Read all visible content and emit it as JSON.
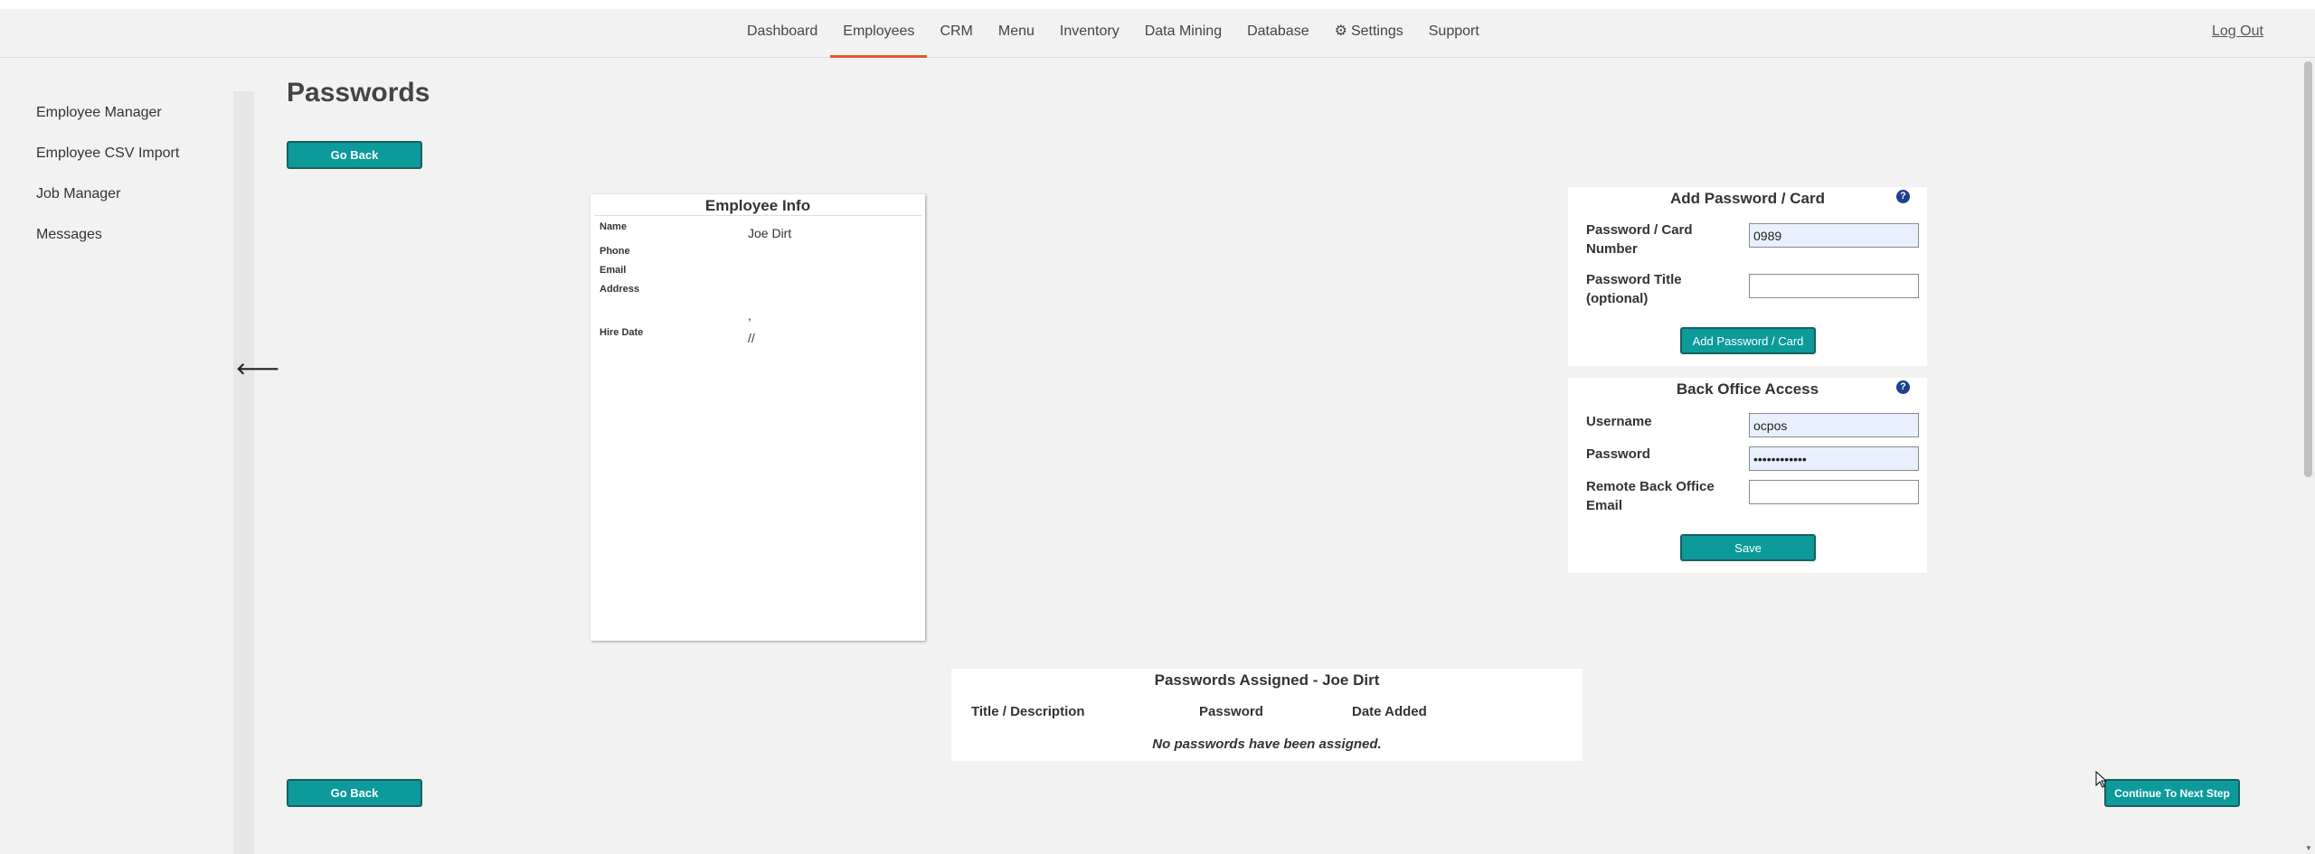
{
  "nav": {
    "links": [
      "Dashboard",
      "Employees",
      "CRM",
      "Menu",
      "Inventory",
      "Data Mining",
      "Database",
      "Settings",
      "Support"
    ],
    "active": "Employees",
    "logout": "Log Out"
  },
  "sidebar": {
    "items": [
      "Employee Manager",
      "Employee CSV Import",
      "Job Manager",
      "Messages"
    ]
  },
  "page": {
    "title": "Passwords",
    "go_back": "Go Back",
    "continue": "Continue To Next Step"
  },
  "employee_info": {
    "title": "Employee Info",
    "labels": {
      "name": "Name",
      "phone": "Phone",
      "email": "Email",
      "address": "Address",
      "hire_date": "Hire Date"
    },
    "values": {
      "name": "Joe Dirt",
      "phone": "",
      "email": "",
      "address_line": ",",
      "hire_date": "//"
    }
  },
  "add_password": {
    "title": "Add Password / Card",
    "number_label_1": "Password / Card",
    "number_label_2": "Number",
    "number_value": "0989",
    "title_label_1": "Password Title",
    "title_label_2": "(optional)",
    "title_value": "",
    "button": "Add Password / Card"
  },
  "back_office": {
    "title": "Back Office Access",
    "username_label": "Username",
    "username_value": "ocpos",
    "password_label": "Password",
    "password_value": "••••••••••••",
    "email_label_1": "Remote Back Office",
    "email_label_2": "Email",
    "email_value": "",
    "button": "Save"
  },
  "assigned": {
    "title": "Passwords Assigned - Joe Dirt",
    "columns": [
      "Title / Description",
      "Password",
      "Date Added"
    ],
    "empty_message": "No passwords have been assigned."
  },
  "icons": {
    "help": "question-circle-icon",
    "collapse": "arrow-left-icon",
    "settings": "gear-icon"
  },
  "colors": {
    "accent_button": "#0c9a9a",
    "active_tab_underline": "#e2572b",
    "help_icon": "#1f3f8f"
  }
}
